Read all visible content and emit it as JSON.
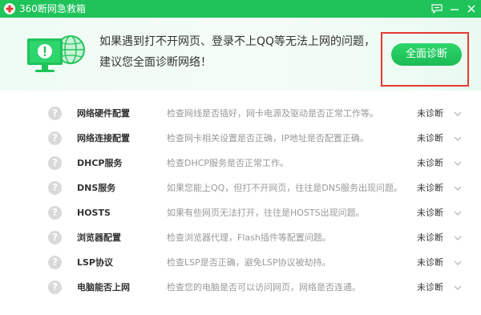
{
  "window": {
    "title": "360断网急救箱",
    "accent": "#1fc35a"
  },
  "banner": {
    "line1": "如果遇到打不开网页、登录不上QQ等无法上网的问题，",
    "line2": "建议您全面诊断网络！",
    "button_label": "全面诊断"
  },
  "items": [
    {
      "name": "网络硬件配置",
      "desc": "检查网线是否插好，网卡电源及驱动是否正常工作等。",
      "status": "未诊断",
      "icon": "?"
    },
    {
      "name": "网络连接配置",
      "desc": "检查网卡相关设置是否正确，IP地址是否配置正确。",
      "status": "未诊断",
      "icon": "?"
    },
    {
      "name": "DHCP服务",
      "desc": "检查DHCP服务是否正常工作。",
      "status": "未诊断",
      "icon": "?"
    },
    {
      "name": "DNS服务",
      "desc": "如果您能上QQ，但打不开网页，往往是DNS服务出现问题。",
      "status": "未诊断",
      "icon": "?"
    },
    {
      "name": "HOSTS",
      "desc": "如果有些网页无法打开，往往是HOSTS出现问题。",
      "status": "未诊断",
      "icon": "?"
    },
    {
      "name": "浏览器配置",
      "desc": "检查浏览器代理，Flash插件等配置问题。",
      "status": "未诊断",
      "icon": "?"
    },
    {
      "name": "LSP协议",
      "desc": "检查LSP是否正确，避免LSP协议被劫持。",
      "status": "未诊断",
      "icon": "?"
    },
    {
      "name": "电脑能否上网",
      "desc": "检查您的电脑是否可以访问网页，网络是否连通。",
      "status": "未诊断",
      "icon": "?"
    }
  ]
}
